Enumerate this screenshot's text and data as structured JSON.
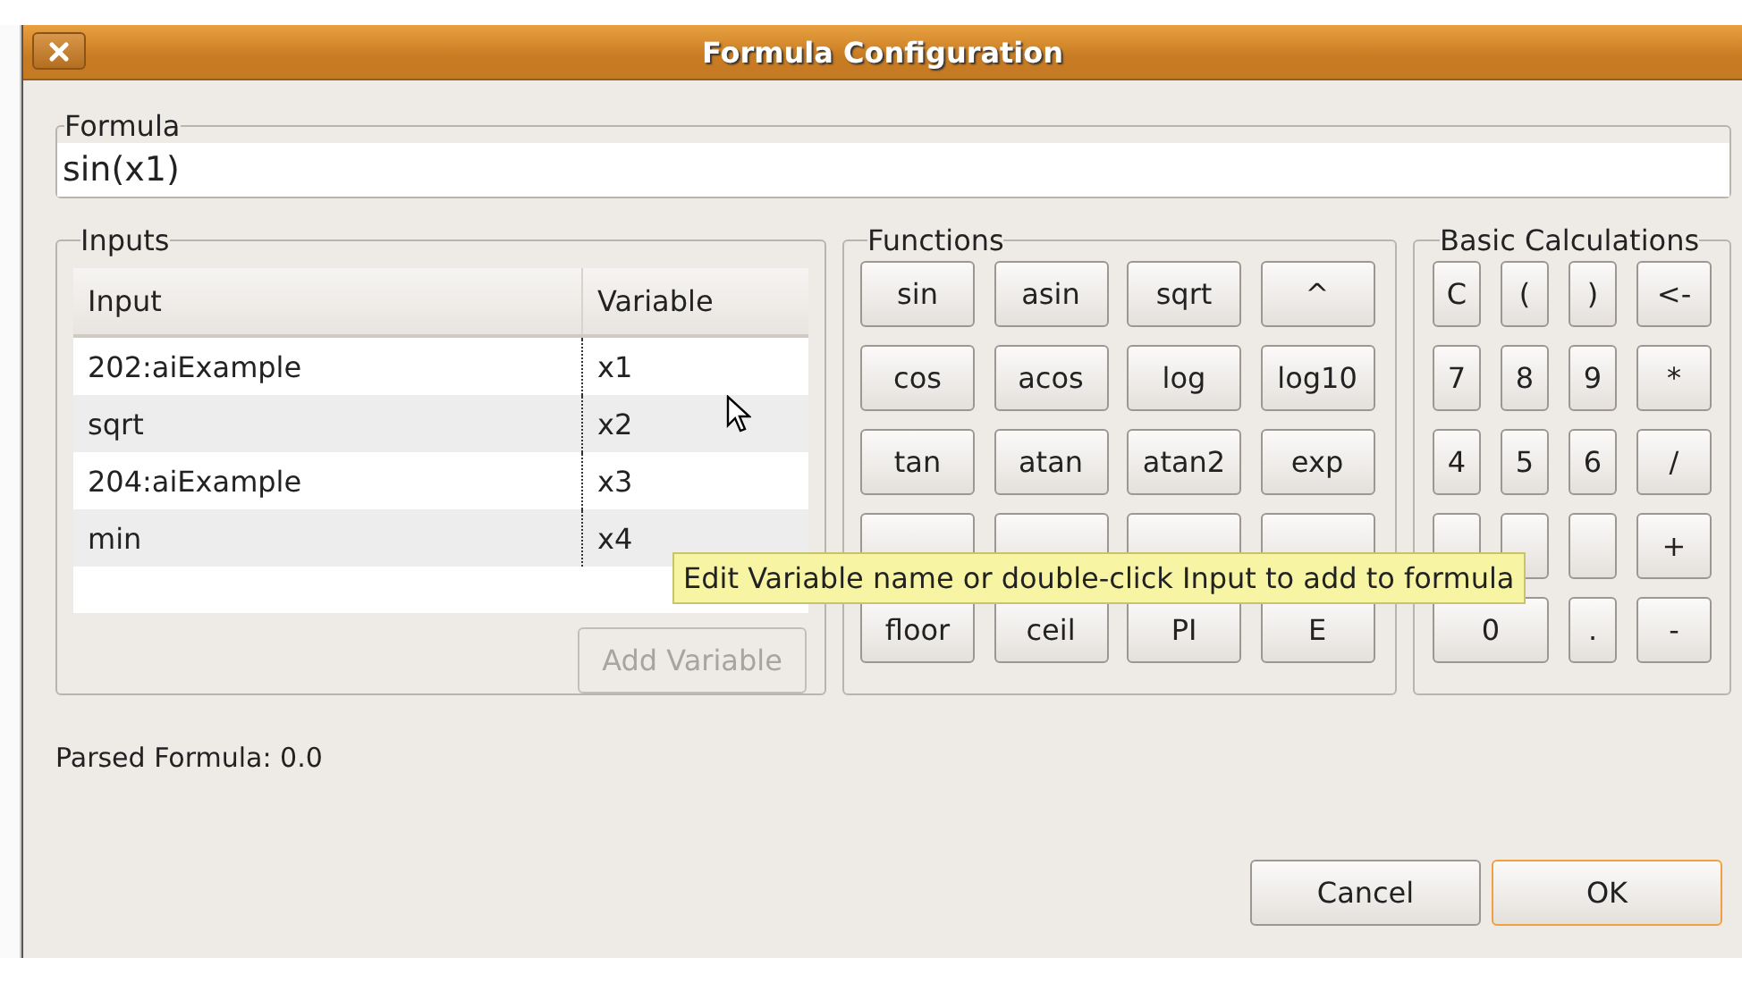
{
  "window": {
    "title": "Formula Configuration"
  },
  "formula": {
    "label": "Formula",
    "value": "sin(x1)"
  },
  "inputs": {
    "label": "Inputs",
    "columns": [
      "Input",
      "Variable"
    ],
    "rows": [
      {
        "input": "202:aiExample",
        "variable": "x1"
      },
      {
        "input": "sqrt",
        "variable": "x2"
      },
      {
        "input": "204:aiExample",
        "variable": "x3"
      },
      {
        "input": "min",
        "variable": "x4"
      }
    ],
    "add_button": {
      "label": "Add Variable",
      "disabled": true
    }
  },
  "functions": {
    "label": "Functions",
    "buttons": [
      {
        "kind": "key",
        "label": "sin"
      },
      {
        "kind": "key",
        "label": "asin"
      },
      {
        "kind": "key",
        "label": "sqrt"
      },
      {
        "kind": "key",
        "label": "^"
      },
      {
        "kind": "key",
        "label": "cos"
      },
      {
        "kind": "key",
        "label": "acos"
      },
      {
        "kind": "key",
        "label": "log"
      },
      {
        "kind": "key",
        "label": "log10"
      },
      {
        "kind": "key",
        "label": "tan"
      },
      {
        "kind": "key",
        "label": "atan"
      },
      {
        "kind": "key",
        "label": "atan2"
      },
      {
        "kind": "key",
        "label": "exp"
      },
      {
        "kind": "covered"
      },
      {
        "kind": "covered"
      },
      {
        "kind": "covered"
      },
      {
        "kind": "covered"
      },
      {
        "kind": "key",
        "label": "floor"
      },
      {
        "kind": "key",
        "label": "ceil"
      },
      {
        "kind": "key",
        "label": "PI"
      },
      {
        "kind": "key",
        "label": "E"
      }
    ]
  },
  "basic": {
    "label": "Basic Calculations",
    "buttons": [
      {
        "kind": "key",
        "label": "C"
      },
      {
        "kind": "key",
        "label": "("
      },
      {
        "kind": "key",
        "label": ")"
      },
      {
        "kind": "key",
        "label": "<-"
      },
      {
        "kind": "key",
        "label": "7"
      },
      {
        "kind": "key",
        "label": "8"
      },
      {
        "kind": "key",
        "label": "9"
      },
      {
        "kind": "key",
        "label": "*"
      },
      {
        "kind": "key",
        "label": "4"
      },
      {
        "kind": "key",
        "label": "5"
      },
      {
        "kind": "key",
        "label": "6"
      },
      {
        "kind": "key",
        "label": "/"
      },
      {
        "kind": "covered"
      },
      {
        "kind": "covered"
      },
      {
        "kind": "covered"
      },
      {
        "kind": "key",
        "label": "+"
      },
      {
        "kind": "wide",
        "label": "0"
      },
      {
        "kind": "key",
        "label": "."
      },
      {
        "kind": "key",
        "label": "-"
      }
    ]
  },
  "tooltip": "Edit Variable name or double-click Input to add to formula",
  "parsed": "Parsed Formula: 0.0",
  "buttons": [
    {
      "label": "Cancel",
      "default": false
    },
    {
      "label": "OK",
      "default": true
    }
  ]
}
